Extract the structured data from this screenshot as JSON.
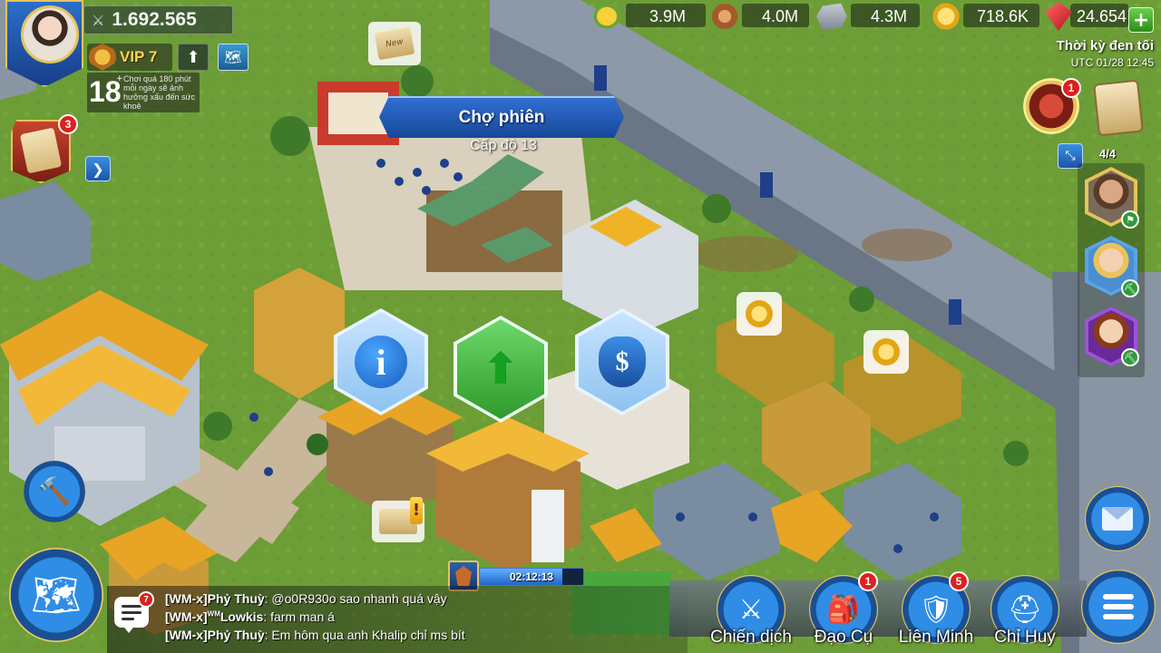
{
  "profile": {
    "power": "1.692.565",
    "vip_label": "VIP 7",
    "age_rating": "18",
    "age_plus": "+",
    "age_warning": "Chơi quá 180 phút mỗi ngày sẽ ảnh hưởng xấu đến sức khoẻ"
  },
  "resources": {
    "food": "3.9M",
    "wood": "4.0M",
    "stone": "4.3M",
    "gold": "718.6K",
    "gems": "24.654"
  },
  "era": {
    "title": "Thời kỳ đen tối",
    "time": "UTC 01/28 12:45"
  },
  "badges": {
    "quests": "3",
    "events": "1",
    "items": "1",
    "alliance": "5",
    "chat": "7"
  },
  "commanders": {
    "count": "4/4"
  },
  "building": {
    "name": "Chợ phiên",
    "level": "Cấp độ 13",
    "new_scroll_text": "New"
  },
  "actions": {
    "info_glyph": "i",
    "upgrade_glyph": "⬆",
    "trade_glyph": "$"
  },
  "timer": {
    "text": "02:12:13",
    "progress_percent": 80
  },
  "chat": [
    {
      "name": "[WM-x]Phỷ Thuỳ",
      "sup": "",
      "message": ": @o0R930o sao nhanh quá vậy"
    },
    {
      "name": "[WM-x]",
      "sup": "WM",
      "name2": "Lowkis",
      "message": ": farm man á"
    },
    {
      "name": "[WM-x]Phỷ Thuỳ",
      "sup": "",
      "message": ": Em hôm qua anh Khalip chỉ ms bít"
    }
  ],
  "nav": {
    "campaign": "Chiến dịch",
    "items": "Đạo Cụ",
    "alliance": "Liên Minh",
    "commander": "Chỉ Huy"
  },
  "icons": {
    "power": "sword-icon",
    "build": "hammer-icon",
    "world": "world-map-icon",
    "menu": "menu-icon",
    "mail": "mail-icon"
  }
}
